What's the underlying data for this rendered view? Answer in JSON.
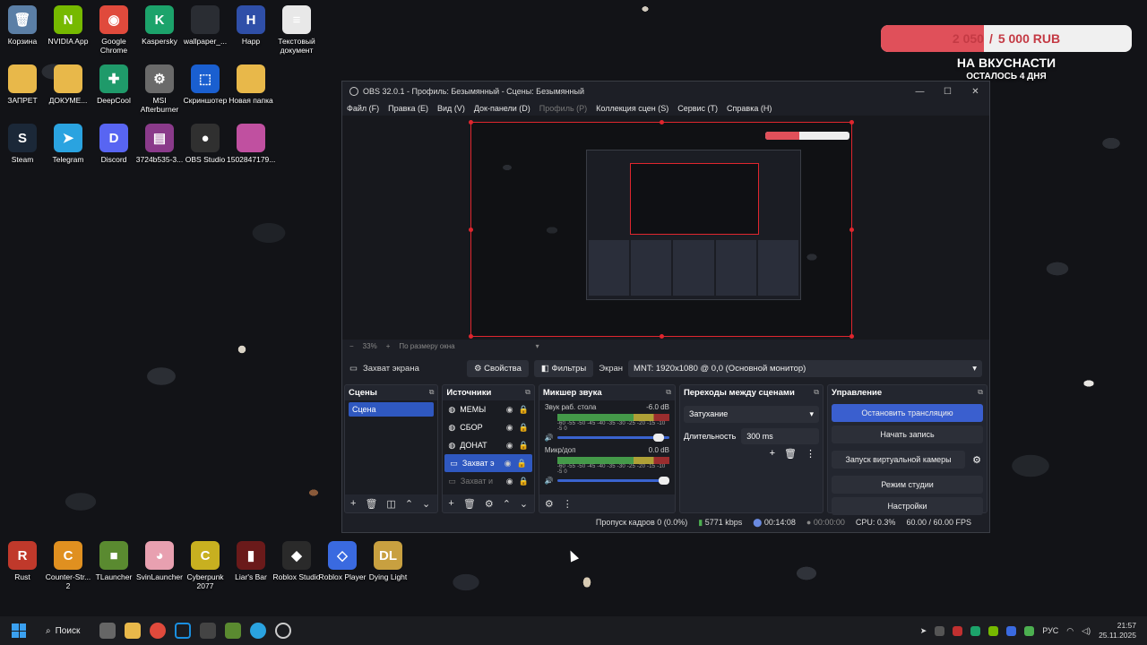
{
  "desktop": {
    "icons_top": [
      {
        "label": "Корзина",
        "icon": "recycle-bin-icon",
        "color": "#5b7fa6",
        "glyph": "🗑"
      },
      {
        "label": "NVIDIA App",
        "icon": "nvidia-icon",
        "color": "#76b900",
        "glyph": "N"
      },
      {
        "label": "Google Chrome",
        "icon": "chrome-icon",
        "color": "#e04a3c",
        "glyph": "◉"
      },
      {
        "label": "Kaspersky",
        "icon": "kaspersky-icon",
        "color": "#1ca36b",
        "glyph": "K"
      },
      {
        "label": "wallpaper_...",
        "icon": "image-file-icon",
        "color": "#2a2d33",
        "glyph": ""
      },
      {
        "label": "Happ",
        "icon": "happ-icon",
        "color": "#2f4fa8",
        "glyph": "H"
      },
      {
        "label": "Текстовый документ",
        "icon": "text-document-icon",
        "color": "#e8e8e8",
        "glyph": "≡"
      }
    ],
    "icons_row2": [
      {
        "label": "ЗАПРЕТ",
        "icon": "folder-icon",
        "color": "#e8b84a",
        "glyph": ""
      },
      {
        "label": "ДОКУМЕ...",
        "icon": "folder-icon",
        "color": "#e8b84a",
        "glyph": ""
      },
      {
        "label": "DeepCool",
        "icon": "deepcool-icon",
        "color": "#1f9a6a",
        "glyph": "✚"
      },
      {
        "label": "MSI Afterburner",
        "icon": "msi-afterburner-icon",
        "color": "#6a6a6a",
        "glyph": "⚙"
      },
      {
        "label": "Скриншотер",
        "icon": "screenshot-icon",
        "color": "#1a5fd0",
        "glyph": "⬚"
      },
      {
        "label": "Новая папка",
        "icon": "folder-icon",
        "color": "#e8b84a",
        "glyph": ""
      }
    ],
    "icons_row3": [
      {
        "label": "Steam",
        "icon": "steam-icon",
        "color": "#1b2838",
        "glyph": "S"
      },
      {
        "label": "Telegram",
        "icon": "telegram-icon",
        "color": "#2aa3e0",
        "glyph": "➤"
      },
      {
        "label": "Discord",
        "icon": "discord-icon",
        "color": "#5865f2",
        "glyph": "D"
      },
      {
        "label": "3724b535-3...",
        "icon": "archive-icon",
        "color": "#8a3a8a",
        "glyph": "▤"
      },
      {
        "label": "OBS Studio",
        "icon": "obs-icon",
        "color": "#303030",
        "glyph": "●"
      },
      {
        "label": "1502847179...",
        "icon": "image-file-icon",
        "color": "#c050a0",
        "glyph": ""
      }
    ],
    "icons_bottom": [
      {
        "label": "Rust",
        "icon": "rust-icon",
        "color": "#c0392b",
        "glyph": "R"
      },
      {
        "label": "Counter-Str... 2",
        "icon": "cs2-icon",
        "color": "#e09020",
        "glyph": "C"
      },
      {
        "label": "TLauncher",
        "icon": "tlauncher-icon",
        "color": "#5a8a30",
        "glyph": "■"
      },
      {
        "label": "SvinLauncher",
        "icon": "svinlauncher-icon",
        "color": "#e8a0b0",
        "glyph": "◕"
      },
      {
        "label": "Cyberpunk 2077",
        "icon": "cyberpunk-icon",
        "color": "#c8b020",
        "glyph": "C"
      },
      {
        "label": "Liar's Bar",
        "icon": "liars-bar-icon",
        "color": "#6a1a1a",
        "glyph": "▮"
      },
      {
        "label": "Roblox Studio",
        "icon": "roblox-studio-icon",
        "color": "#2a2a2a",
        "glyph": "◆"
      },
      {
        "label": "Roblox Player",
        "icon": "roblox-player-icon",
        "color": "#3a6ae0",
        "glyph": "◇"
      },
      {
        "label": "Dying Light",
        "icon": "dying-light-icon",
        "color": "#c8a040",
        "glyph": "DL"
      }
    ]
  },
  "donation": {
    "current": "2 050",
    "separator": "/",
    "goal": "5 000 RUB",
    "progress": 0.41,
    "title": "НА ВКУСНАСТИ",
    "subtitle": "ОСТАЛОСЬ 4 ДНЯ",
    "bar_color": "#e0505a"
  },
  "obs": {
    "title": "OBS 32.0.1 - Профиль: Безымянный - Сцены: Безымянный",
    "window_buttons": [
      "—",
      "☐",
      "✕"
    ],
    "menu": [
      "Файл (F)",
      "Правка (E)",
      "Вид (V)",
      "Док-панели (D)",
      "Профиль (P)",
      "Коллекция сцен (S)",
      "Сервис (T)",
      "Справка (H)"
    ],
    "zoom": {
      "minus": "−",
      "value": "33%",
      "plus": "+",
      "fit": "По размеру окна"
    },
    "source_bar": {
      "source_name": "Захват экрана",
      "properties": "Свойства",
      "filters": "Фильтры",
      "screen_label": "Экран",
      "screen_value": "MNT: 1920x1080 @ 0,0 (Основной монитор)"
    },
    "scenes": {
      "title": "Сцены",
      "items": [
        "Сцена"
      ]
    },
    "sources": {
      "title": "Источники",
      "items": [
        {
          "name": "МЕМЫ",
          "state": "normal"
        },
        {
          "name": "СБОР",
          "state": "normal"
        },
        {
          "name": "ДОНАТ",
          "state": "normal"
        },
        {
          "name": "Захват э",
          "state": "active"
        },
        {
          "name": "Захват и",
          "state": "dim"
        }
      ]
    },
    "mixer": {
      "title": "Микшер звука",
      "scale": "-60 -55 -50 -45 -40 -35 -30 -25 -20 -15 -10 -5 0",
      "channels": [
        {
          "name": "Звук раб. стола",
          "db": "-6.0 dB",
          "volume": 0.95
        },
        {
          "name": "Микр/доп",
          "db": "0.0 dB",
          "volume": 1.0
        }
      ]
    },
    "transitions": {
      "title": "Переходы между сценами",
      "selected": "Затухание",
      "duration_label": "Длительность",
      "duration_value": "300 ms"
    },
    "controls": {
      "title": "Управление",
      "stop_stream": "Остановить трансляцию",
      "start_recording": "Начать запись",
      "virtual_camera": "Запуск виртуальной камеры",
      "studio_mode": "Режим студии",
      "settings": "Настройки"
    },
    "status": {
      "dropped_frames": "Пропуск кадров 0 (0.0%)",
      "bitrate": "5771 kbps",
      "stream_time": "00:14:08",
      "record_time": "00:00:00",
      "cpu": "CPU: 0.3%",
      "fps": "60.00 / 60.00 FPS"
    }
  },
  "taskbar": {
    "search": "Поиск",
    "language": "РУС",
    "time": "21:57",
    "date": "25.11.2025"
  }
}
